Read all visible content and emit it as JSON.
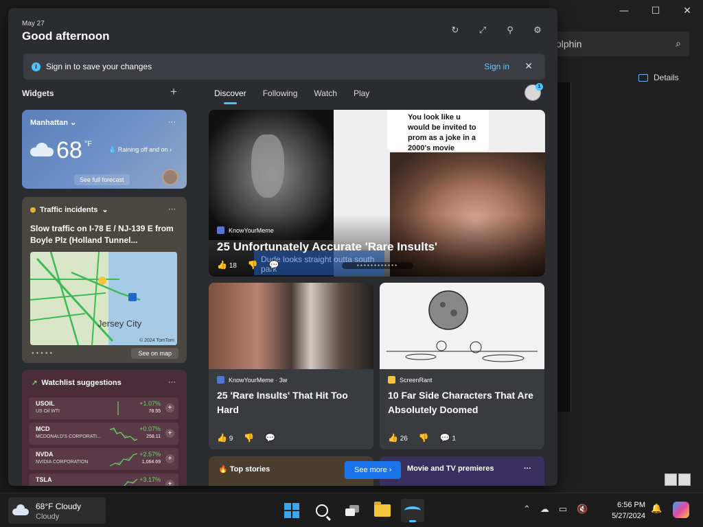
{
  "background_window": {
    "search_text": "olphin",
    "details_label": "Details"
  },
  "board": {
    "date": "May 27",
    "greeting": "Good afternoon",
    "signin_bar": {
      "message": "Sign in to save your changes",
      "link": "Sign in"
    },
    "widgets_label": "Widgets",
    "tabs": [
      "Discover",
      "Following",
      "Watch",
      "Play"
    ],
    "avatar_badge": "1"
  },
  "weather": {
    "city": "Manhattan",
    "temp": "68",
    "unit": "°F",
    "condition": "Raining off and on",
    "forecast_button": "See full forecast"
  },
  "traffic": {
    "title": "Traffic incidents",
    "headline": "Slow traffic on I-78 E / NJ-139 E from Boyle Plz (Holland Tunnel...",
    "map_city": "Jersey City",
    "map_copyright": "© 2024 TomTom",
    "see_map": "See on map"
  },
  "watchlist": {
    "title": "Watchlist suggestions",
    "stocks": [
      {
        "symbol": "USOIL",
        "name": "US Oil WTI",
        "change": "+1.07%",
        "price": "78.55"
      },
      {
        "symbol": "MCD",
        "name": "MCDONALD'S CORPORATI...",
        "change": "+0.07%",
        "price": "258.11"
      },
      {
        "symbol": "NVDA",
        "name": "NVIDIA CORPORATION",
        "change": "+2.57%",
        "price": "1,064.69"
      },
      {
        "symbol": "TSLA",
        "name": "",
        "change": "+3.17%",
        "price": ""
      }
    ]
  },
  "hero": {
    "source": "KnowYourMeme",
    "title": "25 Unfortunately Accurate 'Rare Insults'",
    "likes": "18",
    "bubble_text": "You look like u would be invited to prom as a joke in a 2000's movie",
    "caption": "Dude looks straight outta south park"
  },
  "news": [
    {
      "source": "KnowYourMeme · 3w",
      "title": "25 'Rare Insults' That Hit Too Hard",
      "likes": "9",
      "comments": ""
    },
    {
      "source": "ScreenRant",
      "title": "10 Far Side Characters That Are Absolutely Doomed",
      "likes": "26",
      "comments": "1"
    }
  ],
  "bottom": {
    "top_stories": "Top stories",
    "see_more": "See more",
    "movie_tv": "Movie and TV premieres"
  },
  "taskbar": {
    "weather_temp": "68°F Cloudy",
    "weather_sub": "Cloudy",
    "time": "6:56 PM",
    "date": "5/27/2024"
  },
  "colors": {
    "accent": "#4cc2ff",
    "board_bg": "#2a2c30",
    "positive": "#6ed46e",
    "link": "#6fc8ff"
  }
}
